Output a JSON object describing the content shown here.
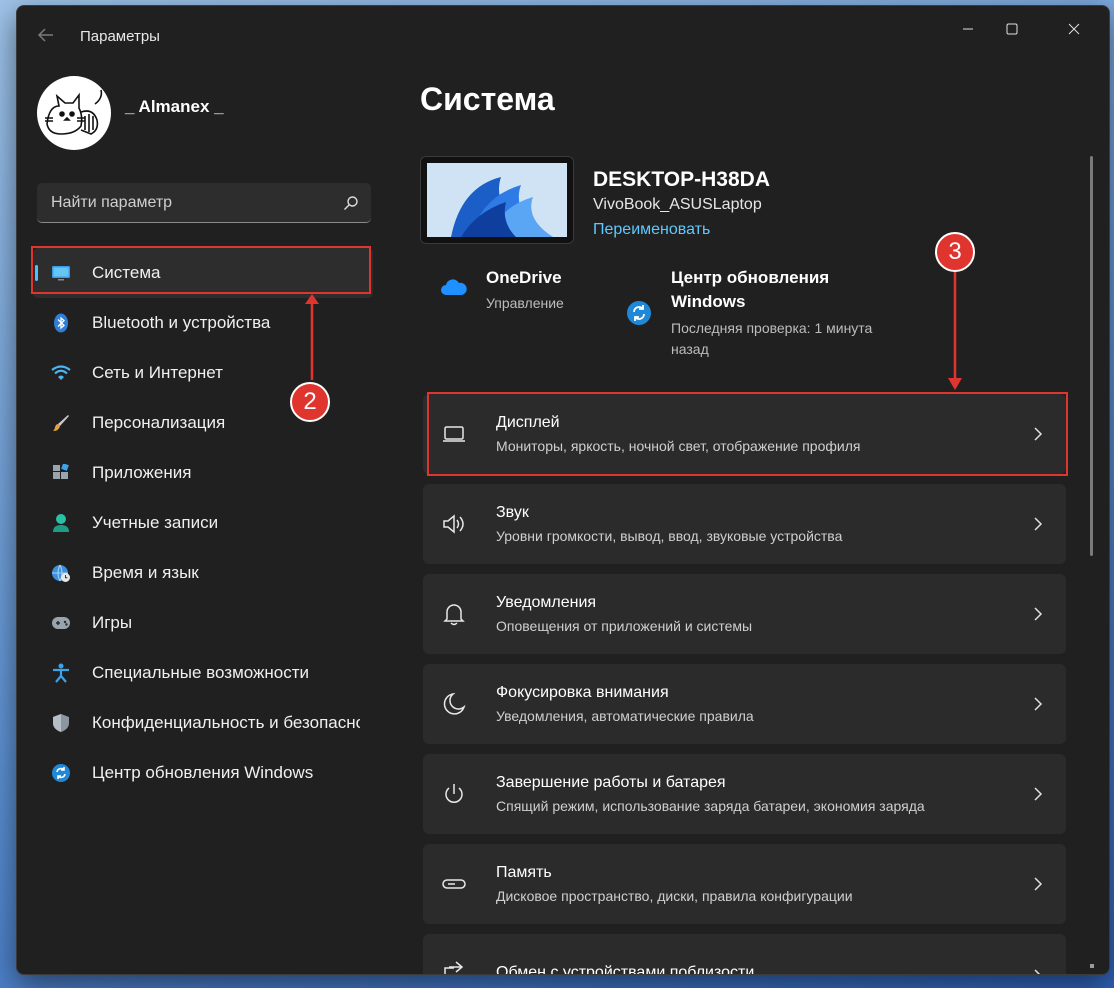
{
  "window": {
    "app_title": "Параметры",
    "buttons": [
      "minimize",
      "maximize",
      "close"
    ]
  },
  "sidebar": {
    "username": "_ Almanex _",
    "search": {
      "placeholder": "Найти параметр"
    },
    "items": [
      {
        "label": "Система",
        "icon": "system-monitor-icon",
        "active": true
      },
      {
        "label": "Bluetooth и устройства",
        "icon": "bluetooth-icon"
      },
      {
        "label": "Сеть и Интернет",
        "icon": "wifi-icon"
      },
      {
        "label": "Персонализация",
        "icon": "paintbrush-icon"
      },
      {
        "label": "Приложения",
        "icon": "apps-icon"
      },
      {
        "label": "Учетные записи",
        "icon": "account-icon"
      },
      {
        "label": "Время и язык",
        "icon": "globe-clock-icon"
      },
      {
        "label": "Игры",
        "icon": "gamepad-icon"
      },
      {
        "label": "Специальные возможности",
        "icon": "accessibility-icon"
      },
      {
        "label": "Конфиденциальность и безопасность",
        "icon": "shield-icon"
      },
      {
        "label": "Центр обновления Windows",
        "icon": "update-icon"
      }
    ]
  },
  "main": {
    "title": "Система",
    "device": {
      "name": "DESKTOP-H38DA",
      "model": "VivoBook_ASUSLaptop",
      "rename_link": "Переименовать"
    },
    "services": [
      {
        "title": "OneDrive",
        "subtitle": "Управление",
        "icon": "onedrive-cloud-icon"
      },
      {
        "title_line1": "Центр обновления",
        "title_line2": "Windows",
        "subtitle_line1": "Последняя проверка: 1 минута",
        "subtitle_line2": "назад",
        "icon": "update-icon"
      }
    ],
    "cards": [
      {
        "title": "Дисплей",
        "subtitle": "Мониторы, яркость, ночной свет, отображение профиля",
        "icon": "display-icon"
      },
      {
        "title": "Звук",
        "subtitle": "Уровни громкости, вывод, ввод, звуковые устройства",
        "icon": "speaker-icon"
      },
      {
        "title": "Уведомления",
        "subtitle": "Оповещения от приложений и системы",
        "icon": "bell-icon"
      },
      {
        "title": "Фокусировка внимания",
        "subtitle": "Уведомления, автоматические правила",
        "icon": "moon-icon"
      },
      {
        "title": "Завершение работы и батарея",
        "subtitle": "Спящий режим, использование заряда батареи, экономия заряда",
        "icon": "power-icon"
      },
      {
        "title": "Память",
        "subtitle": "Дисковое пространство, диски, правила конфигурации",
        "icon": "storage-icon"
      },
      {
        "title": "Обмен с устройствами поблизости",
        "subtitle": "",
        "icon": "share-icon"
      }
    ]
  },
  "annotations": {
    "badge_2": "2",
    "badge_3": "3",
    "color": "#e0342f"
  },
  "colors": {
    "accent": "#4cc2ff",
    "link": "#5fc9ff",
    "window_bg": "#202020",
    "card_bg": "#2b2b2b"
  }
}
